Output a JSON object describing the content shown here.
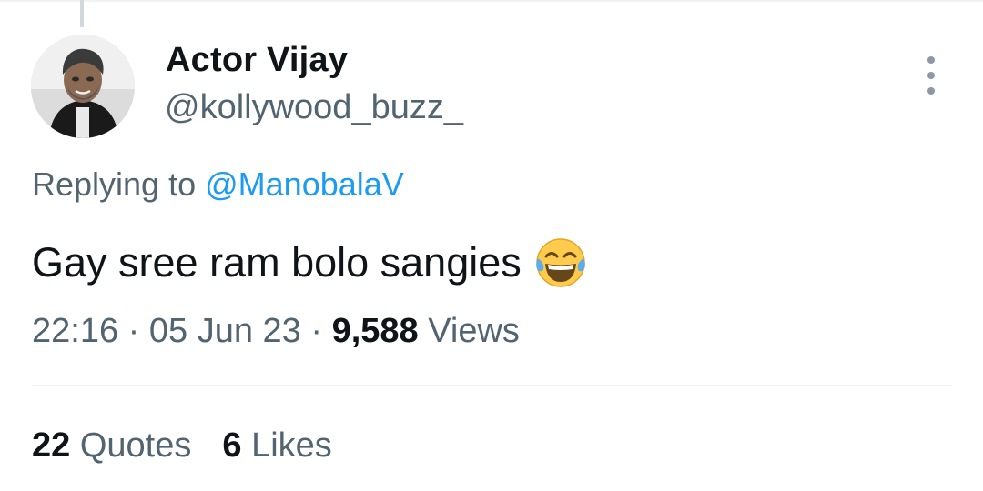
{
  "tweet": {
    "author": {
      "display_name": "Actor Vijay",
      "handle": "@kollywood_buzz_"
    },
    "reply": {
      "prefix": "Replying to",
      "mention": "@ManobalaV"
    },
    "text": "Gay sree ram bolo sangies",
    "emoji": "face-with-tears-of-joy-icon",
    "time": "22:16",
    "date": "05 Jun 23",
    "separator": "·",
    "views_count": "9,588",
    "views_label": "Views",
    "quotes_count": "22",
    "quotes_label": "Quotes",
    "likes_count": "6",
    "likes_label": "Likes"
  },
  "colors": {
    "primary_text": "#0f1419",
    "secondary_text": "#536471",
    "link": "#1d9bf0",
    "divider": "#eff3f4"
  }
}
